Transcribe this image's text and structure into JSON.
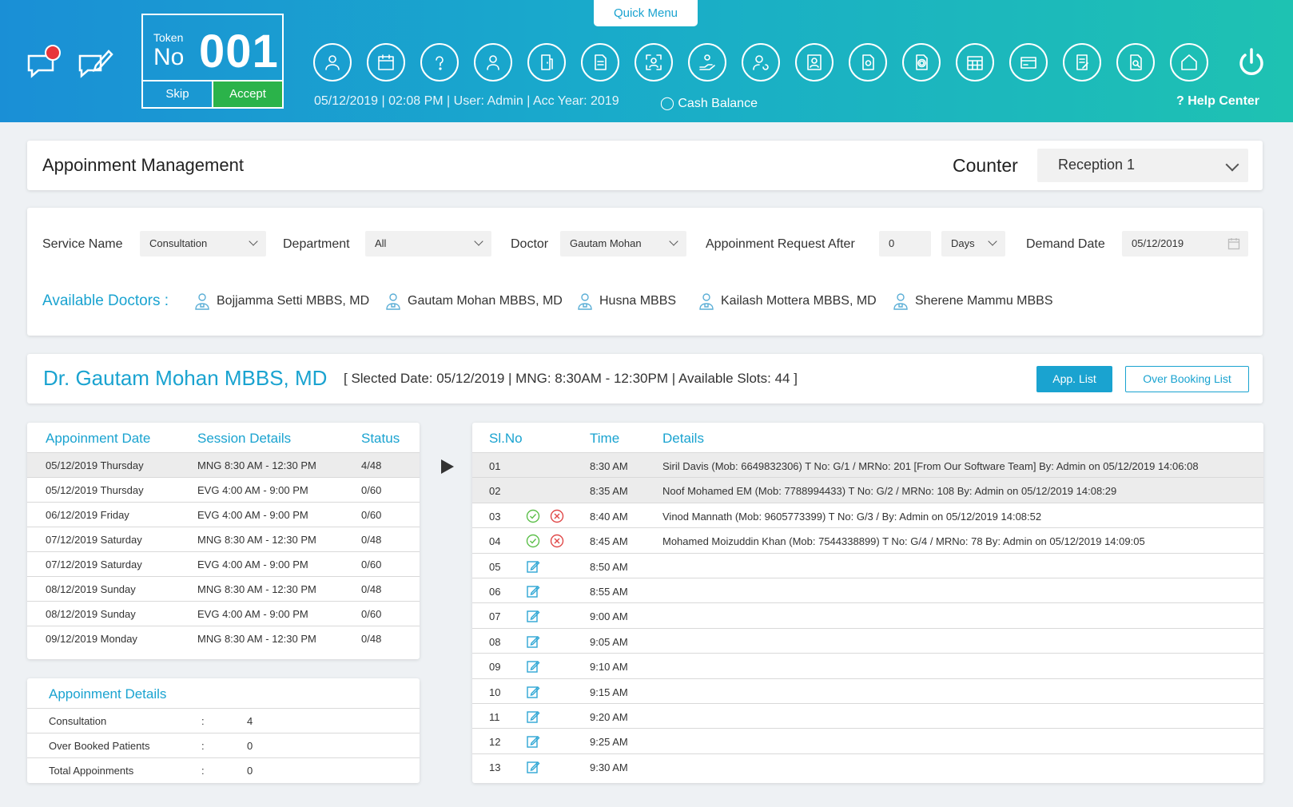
{
  "header": {
    "quick_menu": "Quick Menu",
    "token_label": "Token",
    "token_no": "No",
    "token_number": "001",
    "skip": "Skip",
    "accept": "Accept",
    "status": "05/12/2019 | 02:08 PM | User: Admin | Acc Year: 2019",
    "cash_balance": "Cash Balance",
    "help_center": "? Help Center",
    "toolbar_icons": [
      "user-icon",
      "calendar-icon",
      "help-icon",
      "user-alt-icon",
      "door-icon",
      "document-icon",
      "scan-user-icon",
      "hand-user-icon",
      "user-refresh-icon",
      "id-card-icon",
      "file-coin-icon",
      "file-gear-icon",
      "calendar-grid-icon",
      "card-icon",
      "invoice-icon",
      "report-icon",
      "home-icon"
    ],
    "colors": {
      "gradient_start": "#1a8fd6",
      "gradient_end": "#1ec2b2",
      "accept": "#2bb34a",
      "badge": "#e8353a"
    }
  },
  "title_bar": {
    "title": "Appoinment Management",
    "counter_label": "Counter",
    "counter_value": "Reception 1"
  },
  "filters": {
    "service_label": "Service Name",
    "service_value": "Consultation",
    "department_label": "Department",
    "department_value": "All",
    "doctor_label": "Doctor",
    "doctor_value": "Gautam Mohan",
    "request_after_label": "Appoinment Request After",
    "request_after_value": "0",
    "unit_value": "Days",
    "demand_date_label": "Demand Date",
    "demand_date_value": "05/12/2019",
    "available_label": "Available Doctors :",
    "doctors": [
      "Bojjamma Setti MBBS, MD",
      "Gautam Mohan MBBS, MD",
      "Husna MBBS",
      "Kailash Mottera MBBS, MD",
      "Sherene Mammu MBBS"
    ]
  },
  "doctor_bar": {
    "name": "Dr. Gautam Mohan MBBS, MD",
    "info": "[ Slected Date: 05/12/2019  |  MNG: 8:30AM - 12:30PM  |  Available Slots: 44 ]",
    "app_list": "App. List",
    "over_booking": "Over Booking List"
  },
  "dates_table": {
    "headers": [
      "Appoinment Date",
      "Session Details",
      "Status"
    ],
    "rows": [
      {
        "date": "05/12/2019 Thursday",
        "session": "MNG 8:30 AM - 12:30 PM",
        "status": "4/48"
      },
      {
        "date": "05/12/2019 Thursday",
        "session": "EVG 4:00 AM - 9:00 PM",
        "status": "0/60"
      },
      {
        "date": "06/12/2019 Friday",
        "session": "EVG 4:00 AM - 9:00 PM",
        "status": "0/60"
      },
      {
        "date": "07/12/2019 Saturday",
        "session": "MNG 8:30 AM - 12:30 PM",
        "status": "0/48"
      },
      {
        "date": "07/12/2019 Saturday",
        "session": "EVG 4:00 AM - 9:00 PM",
        "status": "0/60"
      },
      {
        "date": "08/12/2019 Sunday",
        "session": "MNG 8:30 AM - 12:30 PM",
        "status": "0/48"
      },
      {
        "date": "08/12/2019 Sunday",
        "session": "EVG 4:00 AM - 9:00 PM",
        "status": "0/60"
      },
      {
        "date": "09/12/2019 Monday",
        "session": "MNG 8:30 AM - 12:30 PM",
        "status": "0/48"
      }
    ]
  },
  "appointment_details": {
    "title": "Appoinment Details",
    "rows": [
      {
        "label": "Consultation",
        "sep": ":",
        "value": "4"
      },
      {
        "label": "Over Booked Patients",
        "sep": ":",
        "value": "0"
      },
      {
        "label": "Total Appoinments",
        "sep": ":",
        "value": "0"
      }
    ]
  },
  "slots_table": {
    "headers": [
      "Sl.No",
      "Time",
      "Details"
    ],
    "rows": [
      {
        "no": "01",
        "time": "8:30 AM",
        "details": "Siril Davis (Mob: 6649832306) T No: G/1 / MRNo: 201 [From Our Software Team] By: Admin on 05/12/2019 14:06:08",
        "icons": "none"
      },
      {
        "no": "02",
        "time": "8:35 AM",
        "details": "Noof Mohamed EM (Mob: 7788994433) T No: G/2 / MRNo: 108  By: Admin on 05/12/2019 14:08:29",
        "icons": "none"
      },
      {
        "no": "03",
        "time": "8:40 AM",
        "details": "Vinod Mannath (Mob: 9605773399) T No: G/3 / By: Admin on 05/12/2019 14:08:52",
        "icons": "confirm"
      },
      {
        "no": "04",
        "time": "8:45 AM",
        "details": "Mohamed Moizuddin Khan (Mob: 7544338899) T No: G/4 / MRNo: 78 By: Admin on 05/12/2019 14:09:05",
        "icons": "confirm"
      },
      {
        "no": "05",
        "time": "8:50 AM",
        "details": "",
        "icons": "edit"
      },
      {
        "no": "06",
        "time": "8:55 AM",
        "details": "",
        "icons": "edit"
      },
      {
        "no": "07",
        "time": "9:00 AM",
        "details": "",
        "icons": "edit"
      },
      {
        "no": "08",
        "time": "9:05 AM",
        "details": "",
        "icons": "edit"
      },
      {
        "no": "09",
        "time": "9:10 AM",
        "details": "",
        "icons": "edit"
      },
      {
        "no": "10",
        "time": "9:15 AM",
        "details": "",
        "icons": "edit"
      },
      {
        "no": "11",
        "time": "9:20 AM",
        "details": "",
        "icons": "edit"
      },
      {
        "no": "12",
        "time": "9:25 AM",
        "details": "",
        "icons": "edit"
      },
      {
        "no": "13",
        "time": "9:30 AM",
        "details": "",
        "icons": "edit"
      }
    ]
  }
}
